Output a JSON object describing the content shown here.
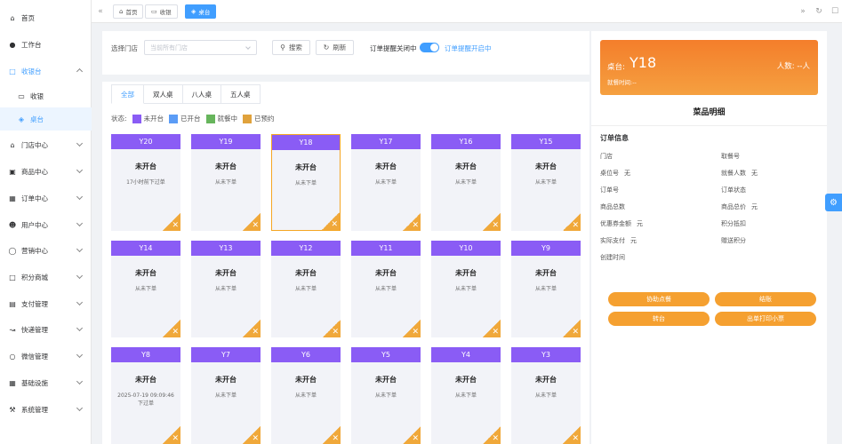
{
  "sidebar": {
    "items": [
      {
        "label": "首页",
        "icon": "home-icon"
      },
      {
        "label": "工作台",
        "icon": "bell-icon"
      },
      {
        "label": "收银台",
        "icon": "cashier-icon"
      },
      {
        "label": "收银",
        "icon": "monitor-icon"
      },
      {
        "label": "桌台",
        "icon": "table-icon"
      },
      {
        "label": "门店中心",
        "icon": "store-icon"
      },
      {
        "label": "商品中心",
        "icon": "cart-icon"
      },
      {
        "label": "订单中心",
        "icon": "order-icon"
      },
      {
        "label": "用户中心",
        "icon": "user-icon"
      },
      {
        "label": "营销中心",
        "icon": "marketing-icon"
      },
      {
        "label": "积分商城",
        "icon": "points-icon"
      },
      {
        "label": "支付管理",
        "icon": "payment-icon"
      },
      {
        "label": "快递管理",
        "icon": "express-icon"
      },
      {
        "label": "微信管理",
        "icon": "wechat-icon"
      },
      {
        "label": "基础设施",
        "icon": "grid-icon"
      },
      {
        "label": "系统管理",
        "icon": "tools-icon"
      }
    ]
  },
  "tabbar": {
    "tabs": [
      {
        "label": "首页",
        "icon": "home-icon"
      },
      {
        "label": "收银",
        "icon": "monitor-icon"
      },
      {
        "label": "桌台",
        "icon": "table-icon",
        "active": true
      }
    ]
  },
  "filter": {
    "store_label": "选择门店",
    "store_placeholder": "当前所有门店",
    "search_label": "搜索",
    "refresh_label": "刷新",
    "reminder_off": "订单提醒关闭中",
    "reminder_on": "订单提醒开启中",
    "reminder_enabled": true
  },
  "table_tabs": [
    "全部",
    "双人桌",
    "八人桌",
    "五人桌"
  ],
  "status": {
    "label": "状态:",
    "legend": [
      {
        "label": "未开台",
        "color": "#8a5cf5"
      },
      {
        "label": "已开台",
        "color": "#5b9cf6"
      },
      {
        "label": "就餐中",
        "color": "#67b55c"
      },
      {
        "label": "已预约",
        "color": "#e0a23c"
      }
    ]
  },
  "tables": [
    {
      "name": "Y20",
      "status": "未开台",
      "note": "17小时前下过单"
    },
    {
      "name": "Y19",
      "status": "未开台",
      "note": "从未下单"
    },
    {
      "name": "Y18",
      "status": "未开台",
      "note": "从未下单",
      "selected": true
    },
    {
      "name": "Y17",
      "status": "未开台",
      "note": "从未下单"
    },
    {
      "name": "Y16",
      "status": "未开台",
      "note": "从未下单"
    },
    {
      "name": "Y15",
      "status": "未开台",
      "note": "从未下单"
    },
    {
      "name": "Y14",
      "status": "未开台",
      "note": "从未下单"
    },
    {
      "name": "Y13",
      "status": "未开台",
      "note": "从未下单"
    },
    {
      "name": "Y12",
      "status": "未开台",
      "note": "从未下单"
    },
    {
      "name": "Y11",
      "status": "未开台",
      "note": "从未下单"
    },
    {
      "name": "Y10",
      "status": "未开台",
      "note": "从未下单"
    },
    {
      "name": "Y9",
      "status": "未开台",
      "note": "从未下单"
    },
    {
      "name": "Y8",
      "status": "未开台",
      "note": "2025-07-19 09:09:46下过单"
    },
    {
      "name": "Y7",
      "status": "未开台",
      "note": "从未下单"
    },
    {
      "name": "Y6",
      "status": "未开台",
      "note": "从未下单"
    },
    {
      "name": "Y5",
      "status": "未开台",
      "note": "从未下单"
    },
    {
      "name": "Y4",
      "status": "未开台",
      "note": "从未下单"
    },
    {
      "name": "Y3",
      "status": "未开台",
      "note": "从未下单"
    }
  ],
  "panel": {
    "table_label": "桌台:",
    "table_name": "Y18",
    "people": "人数: --人",
    "dining_time": "就餐时间:--",
    "title": "菜品明细",
    "section": "订单信息",
    "fields_left": [
      {
        "k": "门店",
        "v": ""
      },
      {
        "k": "桌位号",
        "v": "无"
      },
      {
        "k": "订单号",
        "v": ""
      },
      {
        "k": "商品总数",
        "v": ""
      },
      {
        "k": "优惠券金额",
        "v": "元"
      },
      {
        "k": "实际支付",
        "v": "元"
      },
      {
        "k": "创建时间",
        "v": ""
      }
    ],
    "fields_right": [
      {
        "k": "取餐号",
        "v": ""
      },
      {
        "k": "就餐人数",
        "v": "无"
      },
      {
        "k": "订单状态",
        "v": ""
      },
      {
        "k": "商品总价",
        "v": "元"
      },
      {
        "k": "积分抵扣",
        "v": ""
      },
      {
        "k": "赠送积分",
        "v": ""
      }
    ],
    "buttons": [
      "协助点餐",
      "结账",
      "转台",
      "出单打印小票"
    ]
  },
  "corner_glyph": "✕"
}
